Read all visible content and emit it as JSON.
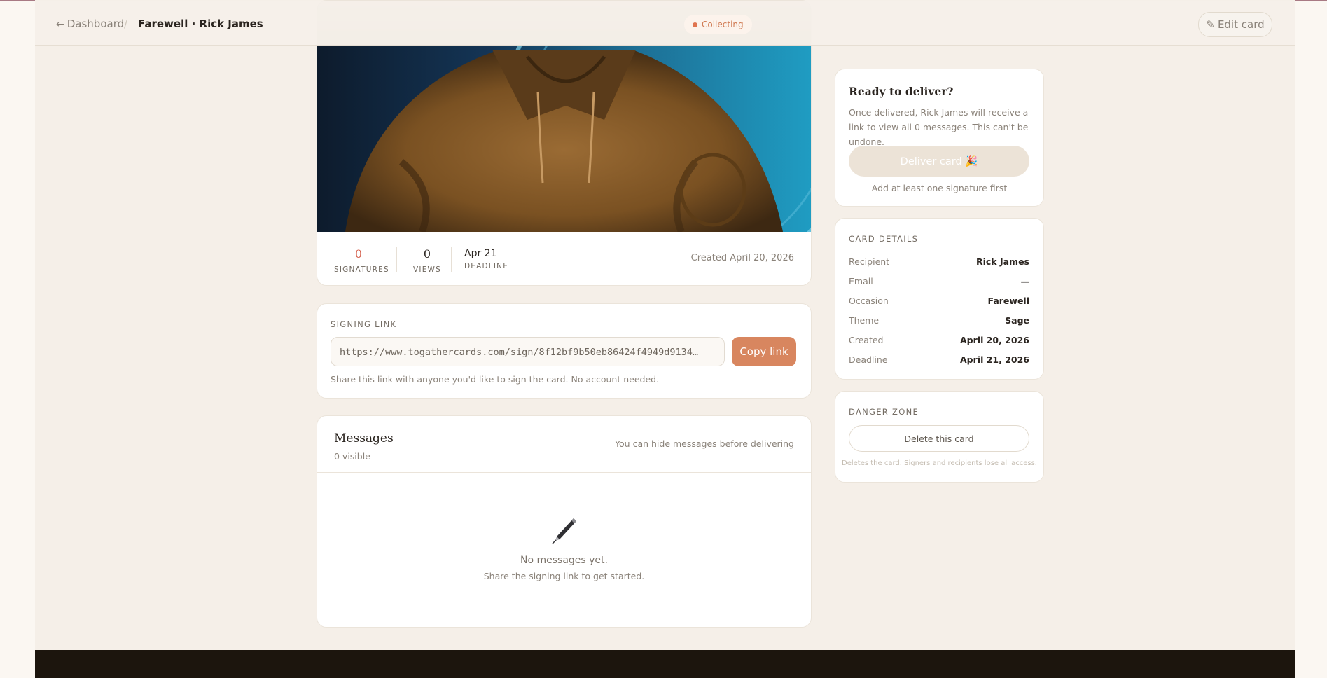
{
  "header": {
    "back_label": "Dashboard",
    "separator": "/",
    "title": "Farewell · Rick James",
    "status": "Collecting",
    "edit_label": "Edit card"
  },
  "stats": {
    "signatures_value": "0",
    "signatures_label": "SIGNATURES",
    "views_value": "0",
    "views_label": "VIEWS",
    "deadline_value": "Apr 21",
    "deadline_label": "DEADLINE",
    "created": "Created April 20, 2026"
  },
  "signing": {
    "label": "SIGNING LINK",
    "url": "https://www.togathercards.com/sign/8f12bf9b50eb86424f4949d9134…",
    "copy_label": "Copy link",
    "hint": "Share this link with anyone you'd like to sign the card. No account needed."
  },
  "messages": {
    "title": "Messages",
    "visible": "0 visible",
    "note": "You can hide messages before delivering",
    "empty_title": "No messages yet.",
    "empty_sub": "Share the signing link to get started."
  },
  "deliver": {
    "heading": "Ready to deliver?",
    "text": "Once delivered, Rick James will receive a link to view all 0 messages. This can't be undone.",
    "button_label": "Deliver card 🎉",
    "hint": "Add at least one signature first"
  },
  "details": {
    "label": "CARD DETAILS",
    "rows": [
      {
        "key": "Recipient",
        "value": "Rick James"
      },
      {
        "key": "Email",
        "value": "—"
      },
      {
        "key": "Occasion",
        "value": "Farewell"
      },
      {
        "key": "Theme",
        "value": "Sage"
      },
      {
        "key": "Created",
        "value": "April 20, 2026"
      },
      {
        "key": "Deadline",
        "value": "April 21, 2026"
      }
    ]
  },
  "danger": {
    "label": "DANGER ZONE",
    "button_label": "Delete this card",
    "hint": "Deletes the card. Signers and recipients lose all access."
  },
  "colors": {
    "accent": "#d8865f",
    "status": "#e07550",
    "background": "#f5efe8",
    "footer": "#1c150d"
  },
  "icons": {
    "back": "arrow-left-icon",
    "edit": "pencil-icon",
    "empty": "fountain-pen-icon"
  }
}
